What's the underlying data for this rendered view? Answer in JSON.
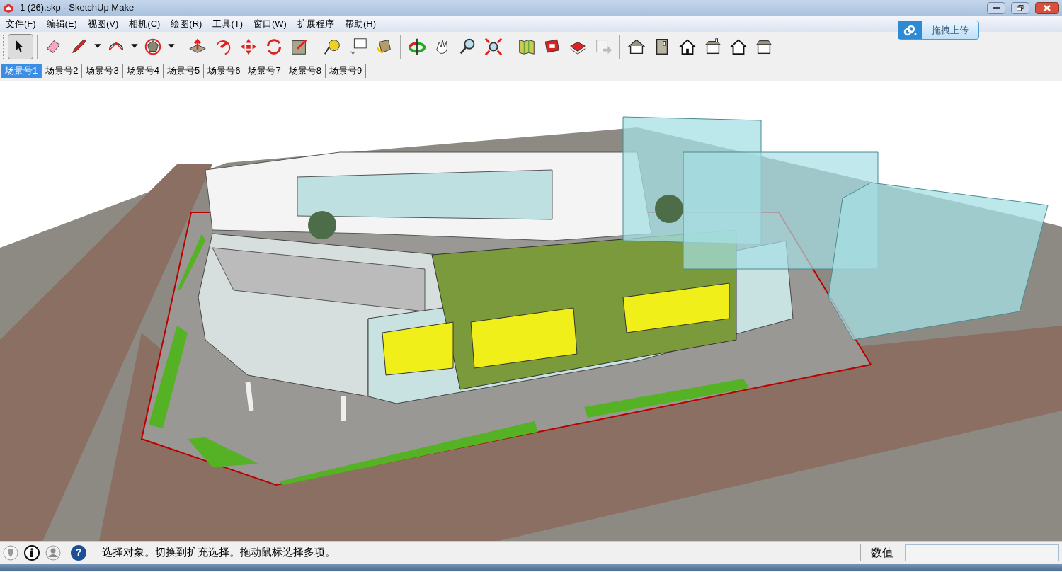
{
  "window": {
    "title": "1 (26).skp - SketchUp Make"
  },
  "menu": [
    "文件(F)",
    "编辑(E)",
    "视图(V)",
    "相机(C)",
    "绘图(R)",
    "工具(T)",
    "窗口(W)",
    "扩展程序",
    "帮助(H)"
  ],
  "upload_button": {
    "label": "拖拽上传"
  },
  "toolbar": [
    {
      "kind": "select",
      "selected": true
    },
    {
      "kind": "sep"
    },
    {
      "kind": "eraser",
      "selected": false
    },
    {
      "kind": "pencil",
      "selected": false
    },
    {
      "kind": "dropdown",
      "selected": false
    },
    {
      "kind": "arc",
      "selected": false
    },
    {
      "kind": "dropdown",
      "selected": false
    },
    {
      "kind": "polygon",
      "selected": false
    },
    {
      "kind": "dropdown",
      "selected": false
    },
    {
      "kind": "sep"
    },
    {
      "kind": "pushpull",
      "selected": false
    },
    {
      "kind": "followme",
      "selected": false
    },
    {
      "kind": "move",
      "selected": false
    },
    {
      "kind": "rotate",
      "selected": false
    },
    {
      "kind": "scale",
      "selected": false
    },
    {
      "kind": "sep"
    },
    {
      "kind": "tape",
      "selected": false
    },
    {
      "kind": "text",
      "selected": false
    },
    {
      "kind": "paint",
      "selected": false
    },
    {
      "kind": "sep"
    },
    {
      "kind": "orbit",
      "selected": false
    },
    {
      "kind": "pan",
      "selected": false
    },
    {
      "kind": "zoom",
      "selected": false
    },
    {
      "kind": "extents",
      "selected": false
    },
    {
      "kind": "sep"
    },
    {
      "kind": "map",
      "selected": false
    },
    {
      "kind": "model",
      "selected": false
    },
    {
      "kind": "share",
      "selected": false
    },
    {
      "kind": "export",
      "selected": false
    },
    {
      "kind": "sep"
    },
    {
      "kind": "iso",
      "selected": false
    },
    {
      "kind": "side",
      "selected": false
    },
    {
      "kind": "front",
      "selected": false
    },
    {
      "kind": "top",
      "selected": false
    },
    {
      "kind": "back",
      "selected": false
    },
    {
      "kind": "right",
      "selected": false
    }
  ],
  "scenes": [
    {
      "label": "场景号1",
      "selected": true
    },
    {
      "label": "场景号2",
      "selected": false
    },
    {
      "label": "场景号3",
      "selected": false
    },
    {
      "label": "场景号4",
      "selected": false
    },
    {
      "label": "场景号5",
      "selected": false
    },
    {
      "label": "场景号6",
      "selected": false
    },
    {
      "label": "场景号7",
      "selected": false
    },
    {
      "label": "场景号8",
      "selected": false
    },
    {
      "label": "场景号9",
      "selected": false
    }
  ],
  "status_bar": {
    "help_icon": "?",
    "message": "选择对象。切换到扩充选择。拖动鼠标选择多项。",
    "measurements_label": "数值"
  }
}
